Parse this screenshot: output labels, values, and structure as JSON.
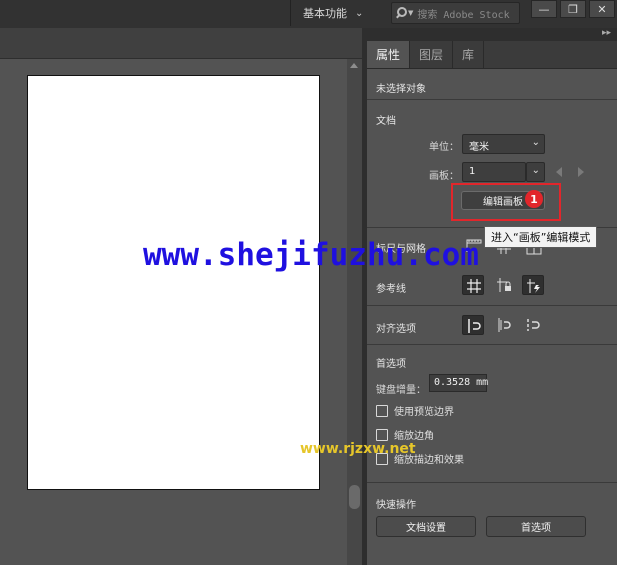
{
  "header": {
    "workspace_label": "基本功能",
    "search_placeholder": "搜索 Adobe Stock",
    "window_minimize": "—",
    "window_restore": "❐",
    "window_close": "✕"
  },
  "panel": {
    "tabs": [
      {
        "label": "属性",
        "active": true
      },
      {
        "label": "图层",
        "active": false
      },
      {
        "label": "库",
        "active": false
      }
    ],
    "no_selection": "未选择对象",
    "document": {
      "title": "文档",
      "units_label": "单位：",
      "units_value": "毫米",
      "artboard_label": "画板：",
      "artboard_value": "1",
      "edit_artboards_label": "编辑画板"
    },
    "rulers_grids_label": "标尺与网格",
    "guides_label": "参考线",
    "snap_options_label": "对齐选项",
    "preferences": {
      "title": "首选项",
      "keyboard_increment_label": "键盘增量：",
      "keyboard_increment_value": "0.3528 mm",
      "use_preview_bounds": "使用预览边界",
      "scale_corners": "缩放边角",
      "scale_strokes_effects": "缩放描边和效果"
    },
    "quick_actions": {
      "title": "快速操作",
      "document_setup": "文档设置",
      "preferences": "首选项"
    }
  },
  "tooltip": "进入“画板”编辑模式",
  "annotation_marker": "1",
  "watermarks": {
    "main": "www.shejifuzhu.com",
    "secondary": "www.rjzxw.net"
  },
  "colors": {
    "highlight": "#e2262b",
    "watermark_main": "#1f10e0",
    "watermark_secondary": "#e6c62a"
  }
}
